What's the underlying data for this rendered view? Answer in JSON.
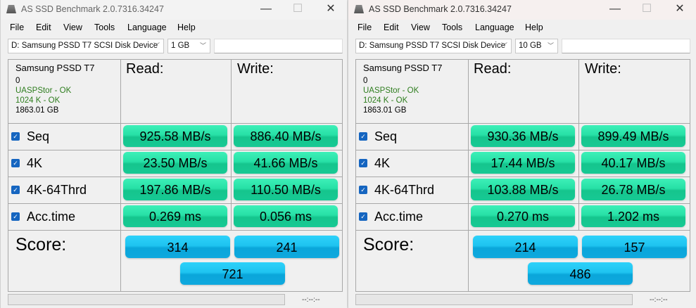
{
  "windows": [
    {
      "title": "AS SSD Benchmark 2.0.7316.34247",
      "menu": [
        "File",
        "Edit",
        "View",
        "Tools",
        "Language",
        "Help"
      ],
      "drive": "D: Samsung PSSD T7 SCSI Disk Device",
      "size": "1 GB",
      "info": {
        "name": "Samsung PSSD T7",
        "line1": "0",
        "driver": "UASPStor - OK",
        "align": "1024 K - OK",
        "capacity": "1863.01 GB"
      },
      "read_label": "Read:",
      "write_label": "Write:",
      "rows": [
        {
          "label": "Seq",
          "read": "925.58 MB/s",
          "write": "886.40 MB/s"
        },
        {
          "label": "4K",
          "read": "23.50 MB/s",
          "write": "41.66 MB/s"
        },
        {
          "label": "4K-64Thrd",
          "read": "197.86 MB/s",
          "write": "110.50 MB/s"
        },
        {
          "label": "Acc.time",
          "read": "0.269 ms",
          "write": "0.056 ms"
        }
      ],
      "score_label": "Score:",
      "score_read": "314",
      "score_write": "241",
      "score_total": "721",
      "time": "--:--:--",
      "active": false
    },
    {
      "title": "AS SSD Benchmark 2.0.7316.34247",
      "menu": [
        "File",
        "Edit",
        "View",
        "Tools",
        "Language",
        "Help"
      ],
      "drive": "D: Samsung PSSD T7 SCSI Disk Device",
      "size": "10 GB",
      "info": {
        "name": "Samsung PSSD T7",
        "line1": "0",
        "driver": "UASPStor - OK",
        "align": "1024 K - OK",
        "capacity": "1863.01 GB"
      },
      "read_label": "Read:",
      "write_label": "Write:",
      "rows": [
        {
          "label": "Seq",
          "read": "930.36 MB/s",
          "write": "899.49 MB/s"
        },
        {
          "label": "4K",
          "read": "17.44 MB/s",
          "write": "40.17 MB/s"
        },
        {
          "label": "4K-64Thrd",
          "read": "103.88 MB/s",
          "write": "26.78 MB/s"
        },
        {
          "label": "Acc.time",
          "read": "0.270 ms",
          "write": "1.202 ms"
        }
      ],
      "score_label": "Score:",
      "score_read": "214",
      "score_write": "157",
      "score_total": "486",
      "time": "--:--:--",
      "active": true
    }
  ],
  "icons": {
    "minimize": "—",
    "maximize": "☐",
    "close": "✕",
    "check": "✓",
    "chevron": "﹀"
  }
}
